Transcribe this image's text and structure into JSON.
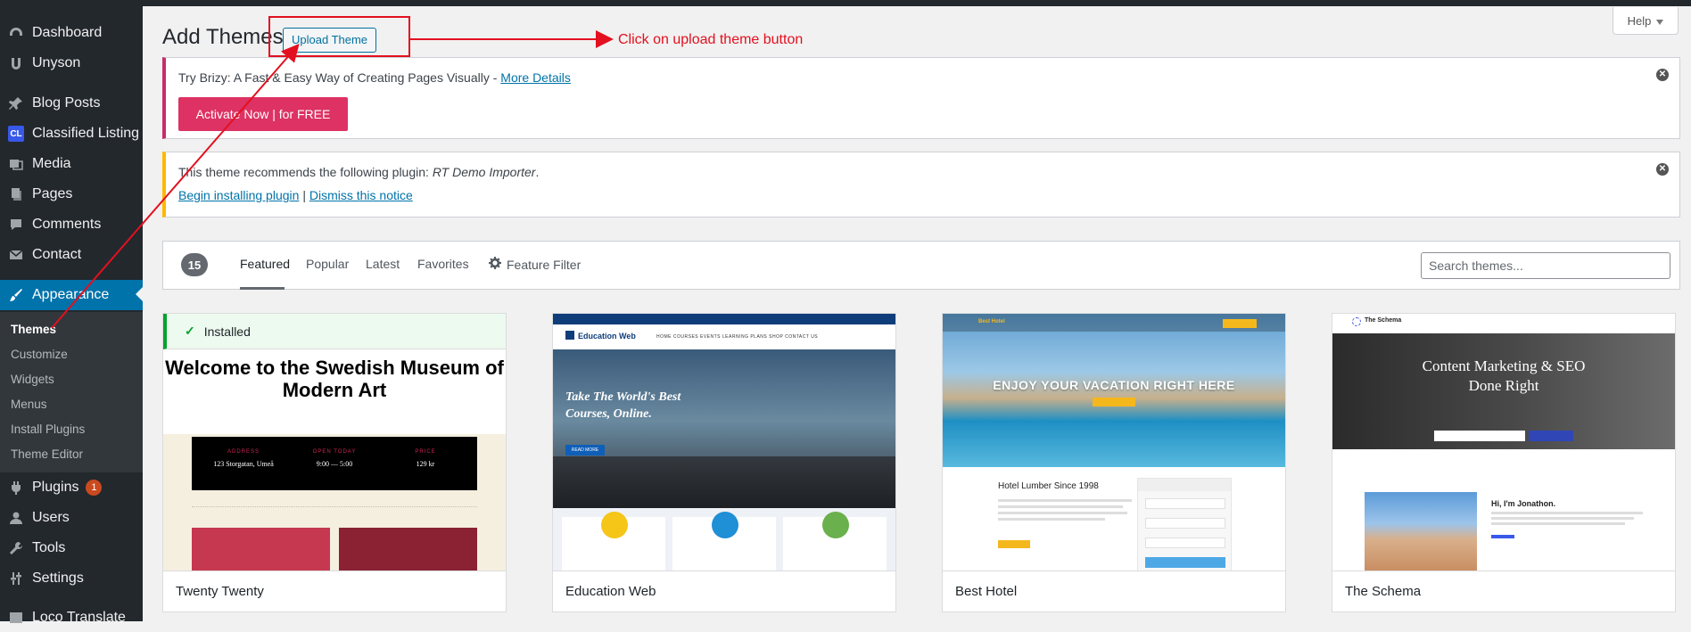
{
  "sidebar": {
    "items": [
      {
        "label": "Dashboard",
        "icon": "dashboard-icon"
      },
      {
        "label": "Unyson",
        "icon": "unyson-icon"
      },
      {
        "label": "Blog Posts",
        "icon": "pin-icon"
      },
      {
        "label": "Classified Listing",
        "icon": "cl-icon",
        "icon_text": "CL"
      },
      {
        "label": "Media",
        "icon": "media-icon"
      },
      {
        "label": "Pages",
        "icon": "pages-icon"
      },
      {
        "label": "Comments",
        "icon": "comments-icon"
      },
      {
        "label": "Contact",
        "icon": "mail-icon"
      },
      {
        "label": "Appearance",
        "icon": "brush-icon"
      },
      {
        "label": "Plugins",
        "icon": "plugin-icon",
        "badge": "1"
      },
      {
        "label": "Users",
        "icon": "users-icon"
      },
      {
        "label": "Tools",
        "icon": "wrench-icon"
      },
      {
        "label": "Settings",
        "icon": "settings-icon"
      },
      {
        "label": "Loco Translate",
        "icon": "translate-icon"
      }
    ],
    "submenu": [
      "Themes",
      "Customize",
      "Widgets",
      "Menus",
      "Install Plugins",
      "Theme Editor"
    ],
    "active_color": "#0073aa"
  },
  "header": {
    "title": "Add Themes",
    "upload_label": "Upload Theme",
    "help_label": "Help"
  },
  "notice_brizy": {
    "text": "Try Brizy: A Fast & Easy Way of Creating Pages Visually - ",
    "link": "More Details",
    "button": "Activate Now | for FREE"
  },
  "notice_plugin": {
    "text": "This theme recommends the following plugin: ",
    "plugin": "RT Demo Importer",
    "period": ".",
    "link_install": "Begin installing plugin",
    "separator": " | ",
    "link_dismiss": "Dismiss this notice"
  },
  "filter": {
    "count": "15",
    "tabs": [
      "Featured",
      "Popular",
      "Latest",
      "Favorites"
    ],
    "feature_filter": "Feature Filter",
    "search_placeholder": "Search themes..."
  },
  "themes": [
    {
      "name": "Twenty Twenty",
      "installed_label": "Installed",
      "preview": {
        "heading": "Welcome to the Swedish Museum of Modern Art",
        "cols": [
          {
            "label": "ADDRESS",
            "value": "123 Storgatan, Umeå"
          },
          {
            "label": "OPEN TODAY",
            "value": "9:00 — 5:00"
          },
          {
            "label": "PRICE",
            "value": "129 kr"
          }
        ]
      }
    },
    {
      "name": "Education Web",
      "preview": {
        "logo": "Education Web",
        "menu": "HOME   COURSES   EVENTS   LEARNING PLANS   SHOP   CONTACT US",
        "headline": "Take The World's Best Courses, Online.",
        "cta": "READ MORE"
      }
    },
    {
      "name": "Best Hotel",
      "preview": {
        "logo": "Best Hotel",
        "headline": "ENJOY YOUR VACATION RIGHT HERE",
        "subheading": "Hotel Lumber Since 1998"
      }
    },
    {
      "name": "The Schema",
      "preview": {
        "logo": "The Schema",
        "headline": "Content Marketing & SEO Done Right",
        "greeting": "Hi, I'm Jonathon."
      }
    }
  ],
  "annotation": {
    "text": "Click on upload theme button",
    "color": "#e3101f"
  }
}
